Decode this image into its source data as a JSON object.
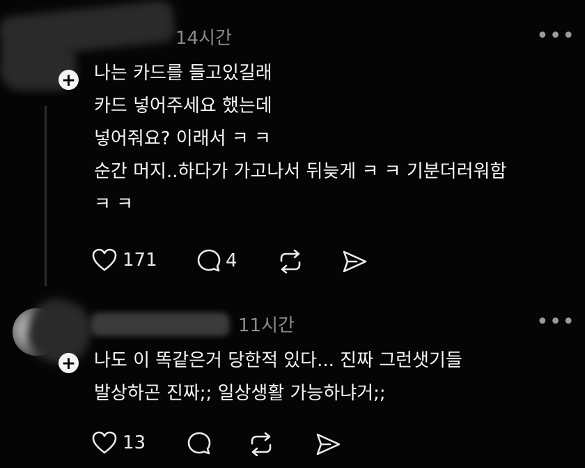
{
  "comment1": {
    "time": "14시간",
    "more": "•••",
    "lines": [
      "나는 카드를 들고있길래",
      "카드 넣어주세요 했는데",
      "넣어줘요? 이래서 ㅋ ㅋ",
      "순간 머지..하다가 가고나서 뒤늦게 ㅋ ㅋ 기분더러워함",
      "ㅋ ㅋ"
    ],
    "likes": "171",
    "replies": "4"
  },
  "comment2": {
    "time": "11시간",
    "more": "•••",
    "lines": [
      "나도 이 똑같은거 당한적 있다... 진짜 그런샛기들",
      "발상하곤 진짜;; 일상생활 가능하냐거;;"
    ],
    "likes": "13"
  },
  "icons": {
    "like": "heart-icon",
    "reply": "comment-icon",
    "repost": "repost-icon",
    "share": "send-icon",
    "follow": "plus-icon"
  },
  "colors": {
    "background": "#050505",
    "text": "#f5f5f5",
    "muted": "#8a8a8a",
    "thread_line": "#2c2c2c"
  }
}
